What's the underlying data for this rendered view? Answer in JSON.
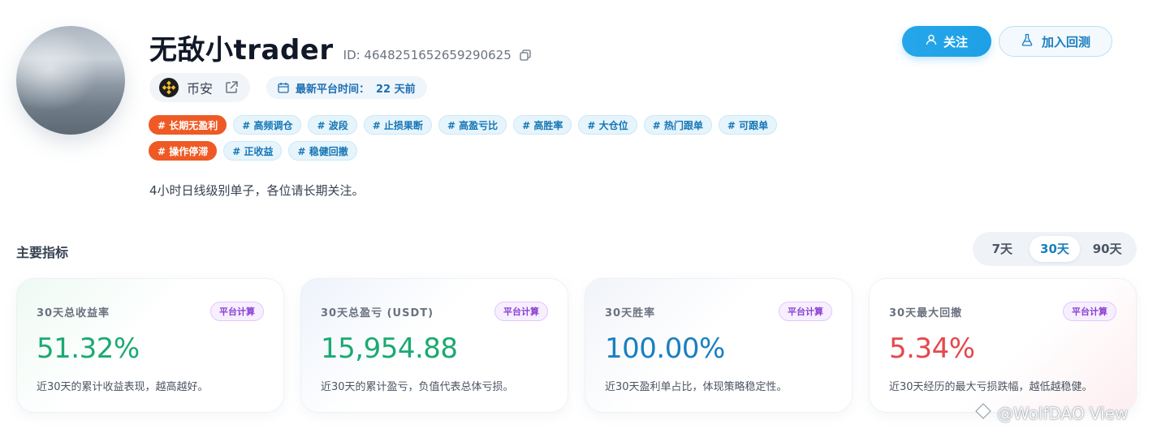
{
  "profile": {
    "name": "无敌小trader",
    "id_text": "ID: 4648251652659290625",
    "exchange": "币安",
    "latest_trade_label": "最新平台时间：",
    "latest_trade_value": "22 天前",
    "bio": "4小时日线级别单子，各位请长期关注。"
  },
  "actions": {
    "follow": "关注",
    "backtest": "加入回测"
  },
  "tags": [
    {
      "label": "# 长期无盈利",
      "hot": true
    },
    {
      "label": "# 高频调仓",
      "hot": false
    },
    {
      "label": "# 波段",
      "hot": false
    },
    {
      "label": "# 止损果断",
      "hot": false
    },
    {
      "label": "# 高盈亏比",
      "hot": false
    },
    {
      "label": "# 高胜率",
      "hot": false
    },
    {
      "label": "# 大仓位",
      "hot": false
    },
    {
      "label": "# 热门跟单",
      "hot": false
    },
    {
      "label": "# 可跟单",
      "hot": false
    },
    {
      "label": "# 操作停滞",
      "hot": true
    },
    {
      "label": "# 正收益",
      "hot": false
    },
    {
      "label": "# 稳健回撤",
      "hot": false
    }
  ],
  "metrics": {
    "section_title": "主要指标",
    "ranges": [
      "7天",
      "30天",
      "90天"
    ],
    "active_range": "30天",
    "badge": "平台计算",
    "cards": [
      {
        "label": "30天总收益率",
        "value": "51.32%",
        "desc": "近30天的累计收益表现，越高越好。",
        "color": "#1aaa72"
      },
      {
        "label": "30天总盈亏 (USDT)",
        "value": "15,954.88",
        "desc": "近30天的累计盈亏，负值代表总体亏损。",
        "color": "#1aaa72"
      },
      {
        "label": "30天胜率",
        "value": "100.00%",
        "desc": "近30天盈利单占比，体现策略稳定性。",
        "color": "#1a7fc0"
      },
      {
        "label": "30天最大回撤",
        "value": "5.34%",
        "desc": "近30天经历的最大亏损跌幅，越低越稳健。",
        "color": "#e5484d"
      }
    ]
  },
  "watermark": "@WolfDAO View"
}
